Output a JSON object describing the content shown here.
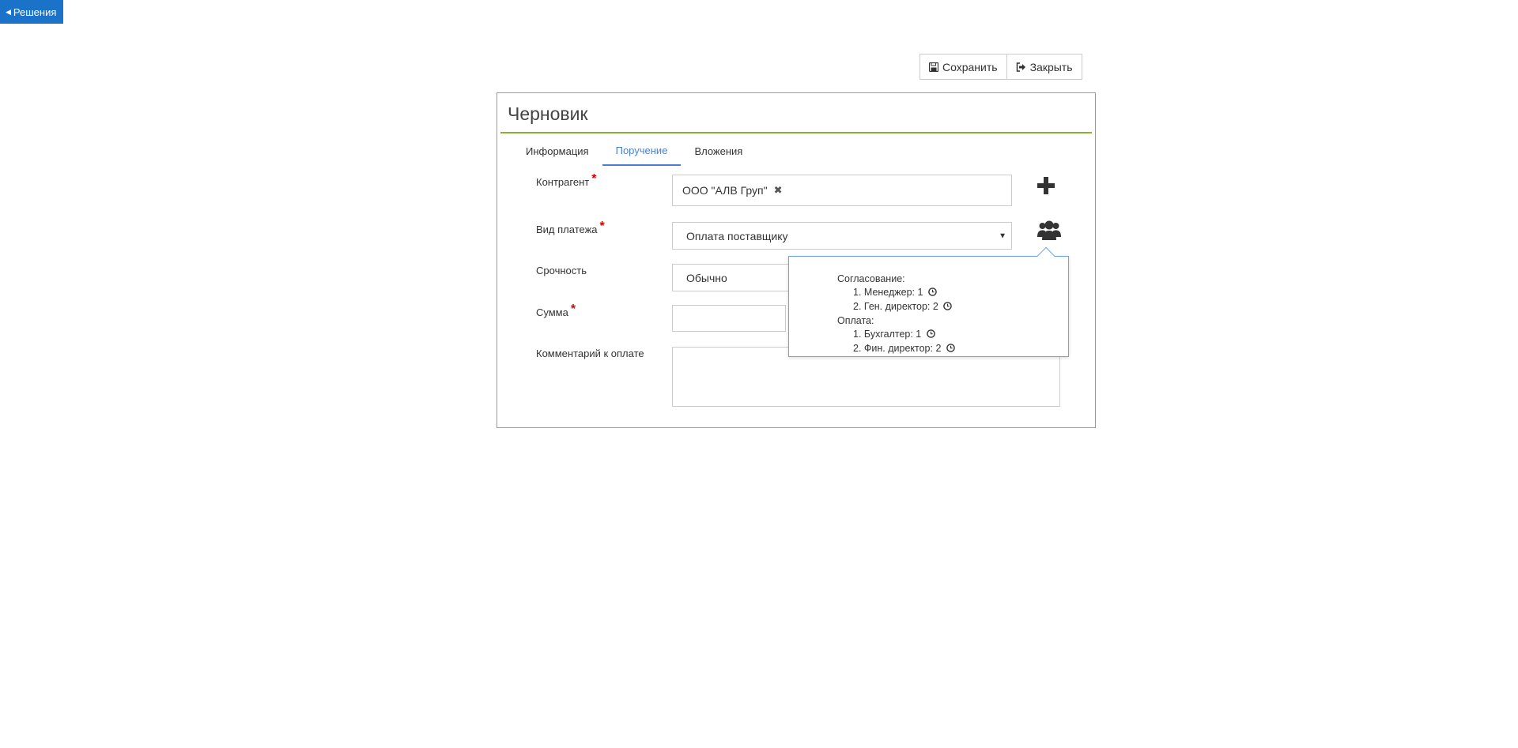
{
  "nav": {
    "back_label": "Решения"
  },
  "toolbar": {
    "save_label": "Сохранить",
    "close_label": "Закрыть"
  },
  "panel": {
    "title": "Черновик",
    "tabs": [
      {
        "label": "Информация",
        "active": false
      },
      {
        "label": "Поручение",
        "active": true
      },
      {
        "label": "Вложения",
        "active": false
      }
    ]
  },
  "form": {
    "counterparty": {
      "label": "Контрагент",
      "required": "*",
      "value": "ООО \"АЛВ Груп\""
    },
    "payment_type": {
      "label": "Вид платежа",
      "required": "*",
      "value": "Оплата поставщику"
    },
    "urgency": {
      "label": "Срочность",
      "value": "Обычно"
    },
    "amount": {
      "label": "Сумма",
      "required": "*",
      "value": ""
    },
    "comment": {
      "label": "Комментарий к оплате",
      "value": ""
    }
  },
  "popover": {
    "groups": [
      {
        "title": "Согласование:",
        "items": [
          "1. Менеджер: 1",
          "2. Ген. директор: 2"
        ]
      },
      {
        "title": "Оплата:",
        "items": [
          "1. Бухгалтер: 1",
          "2. Фин. директор: 2"
        ]
      }
    ]
  },
  "icons": {
    "add": "plus-icon",
    "approvers": "users-icon",
    "save": "floppy-disk-icon",
    "close": "sign-out-icon",
    "time": "clock-icon"
  },
  "colors": {
    "accent": "#1a73c9",
    "tab_active": "#4a7fd3",
    "title_rule": "#8ab031",
    "required": "#d90000",
    "popover_border": "#6fa3e6"
  }
}
